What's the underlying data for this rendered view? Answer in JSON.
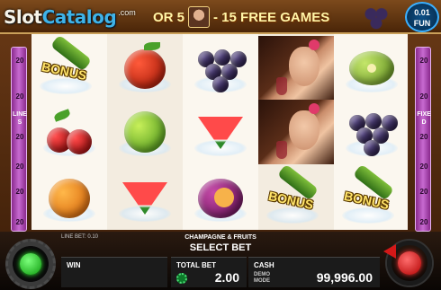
{
  "header": {
    "logo_slot": "Slot",
    "logo_catalog": "Catalog",
    "logo_com": ".com",
    "promo_left": "OR 5",
    "promo_right": "- 15 FREE GAMES",
    "denomination": "0.01",
    "mode": "FUN"
  },
  "left_panel": {
    "numbers": [
      "20",
      "20",
      "20",
      "20",
      "20",
      "20"
    ],
    "word": "LINES"
  },
  "right_panel": {
    "numbers": [
      "20",
      "20",
      "20",
      "20",
      "20",
      "20"
    ],
    "word": "FIXED"
  },
  "reels": [
    [
      "champagne-bonus",
      "cherries",
      "orange"
    ],
    [
      "apple",
      "lime",
      "watermelon"
    ],
    [
      "grapes",
      "watermelon",
      "plum"
    ],
    [
      "woman",
      "woman",
      "champagne-bonus"
    ],
    [
      "kiwi",
      "grapes",
      "champagne-bonus"
    ]
  ],
  "bonus_label": "BONUS",
  "bottom": {
    "game_title": "CHAMPAGNE & FRUITS",
    "line_bet": "LINE BET: 0.10",
    "select_bet": "SELECT BET",
    "win_label": "WIN",
    "win_value": "",
    "total_bet_label": "TOTAL BET",
    "total_bet_value": "2.00",
    "cash_label": "CASH",
    "demo_line1": "DEMO",
    "demo_line2": "MODE",
    "cash_value": "99,996.00"
  }
}
